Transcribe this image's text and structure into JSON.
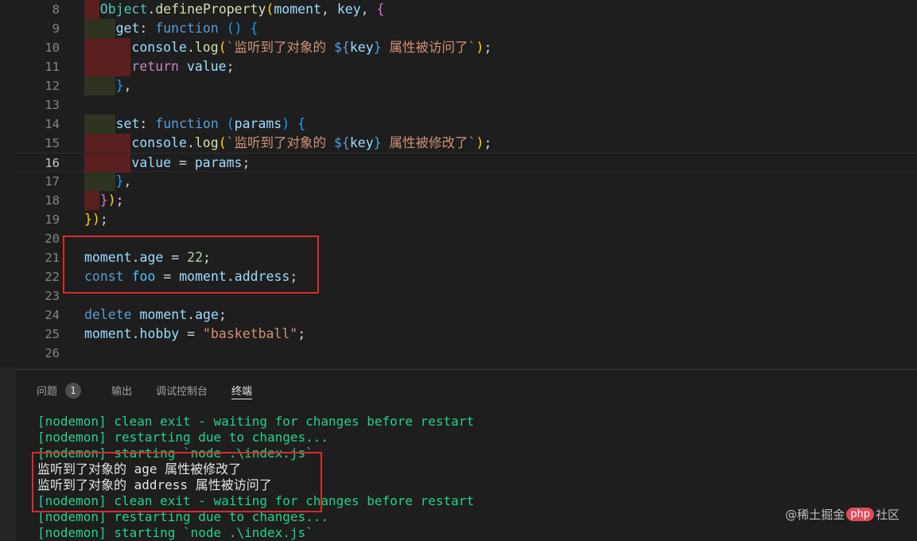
{
  "editor": {
    "lines": [
      {
        "n": "8",
        "tokens": [
          [
            "Object",
            "#4ec9b0"
          ],
          [
            ".",
            "#d4d4d4"
          ],
          [
            "defineProperty",
            "#dcdcaa"
          ],
          [
            "(",
            "#ffd700"
          ],
          [
            "moment",
            "#9cdcfe"
          ],
          [
            ", ",
            "#d4d4d4"
          ],
          [
            "key",
            "#9cdcfe"
          ],
          [
            ", ",
            "#d4d4d4"
          ],
          [
            "{",
            "#da70d6"
          ]
        ]
      },
      {
        "n": "9",
        "tokens": [
          [
            "get",
            "#9cdcfe"
          ],
          [
            ": ",
            "#d4d4d4"
          ],
          [
            "function",
            "#569cd6"
          ],
          [
            " ",
            "#d4d4d4"
          ],
          [
            "()",
            "#179fff"
          ],
          [
            " ",
            "#d4d4d4"
          ],
          [
            "{",
            "#179fff"
          ]
        ]
      },
      {
        "n": "10",
        "tokens": [
          [
            "console",
            "#9cdcfe"
          ],
          [
            ".",
            "#d4d4d4"
          ],
          [
            "log",
            "#dcdcaa"
          ],
          [
            "(",
            "#ffd700"
          ],
          [
            "`监听到了对象的 ",
            "#ce9178"
          ],
          [
            "${",
            "#569cd6"
          ],
          [
            "key",
            "#9cdcfe"
          ],
          [
            "}",
            "#569cd6"
          ],
          [
            " 属性被访问了`",
            "#ce9178"
          ],
          [
            ")",
            "#ffd700"
          ],
          [
            ";",
            "#d4d4d4"
          ]
        ]
      },
      {
        "n": "11",
        "tokens": [
          [
            "return",
            "#c586c0"
          ],
          [
            " ",
            "#d4d4d4"
          ],
          [
            "value",
            "#9cdcfe"
          ],
          [
            ";",
            "#d4d4d4"
          ]
        ]
      },
      {
        "n": "12",
        "tokens": [
          [
            "}",
            "#179fff"
          ],
          [
            ",",
            "#d4d4d4"
          ]
        ]
      },
      {
        "n": "13",
        "tokens": []
      },
      {
        "n": "14",
        "tokens": [
          [
            "set",
            "#9cdcfe"
          ],
          [
            ": ",
            "#d4d4d4"
          ],
          [
            "function",
            "#569cd6"
          ],
          [
            " ",
            "#d4d4d4"
          ],
          [
            "(",
            "#179fff"
          ],
          [
            "params",
            "#9cdcfe"
          ],
          [
            ")",
            "#179fff"
          ],
          [
            " ",
            "#d4d4d4"
          ],
          [
            "{",
            "#179fff"
          ]
        ]
      },
      {
        "n": "15",
        "tokens": [
          [
            "console",
            "#9cdcfe"
          ],
          [
            ".",
            "#d4d4d4"
          ],
          [
            "log",
            "#dcdcaa"
          ],
          [
            "(",
            "#ffd700"
          ],
          [
            "`监听到了对象的 ",
            "#ce9178"
          ],
          [
            "${",
            "#569cd6"
          ],
          [
            "key",
            "#9cdcfe"
          ],
          [
            "}",
            "#569cd6"
          ],
          [
            " 属性被修改了`",
            "#ce9178"
          ],
          [
            ")",
            "#ffd700"
          ],
          [
            ";",
            "#d4d4d4"
          ]
        ]
      },
      {
        "n": "16",
        "tokens": [
          [
            "value",
            "#9cdcfe"
          ],
          [
            " = ",
            "#d4d4d4"
          ],
          [
            "params",
            "#9cdcfe"
          ],
          [
            ";",
            "#d4d4d4"
          ]
        ]
      },
      {
        "n": "17",
        "tokens": [
          [
            "}",
            "#179fff"
          ],
          [
            ",",
            "#d4d4d4"
          ]
        ]
      },
      {
        "n": "18",
        "tokens": [
          [
            "}",
            "#da70d6"
          ],
          [
            ")",
            "#ffd700"
          ],
          [
            ";",
            "#d4d4d4"
          ]
        ]
      },
      {
        "n": "19",
        "tokens": [
          [
            "}",
            "#ffd700"
          ],
          [
            ")",
            "#ffd700"
          ],
          [
            ";",
            "#d4d4d4"
          ]
        ]
      },
      {
        "n": "20",
        "tokens": []
      },
      {
        "n": "21",
        "tokens": [
          [
            "moment",
            "#9cdcfe"
          ],
          [
            ".",
            "#d4d4d4"
          ],
          [
            "age",
            "#9cdcfe"
          ],
          [
            " = ",
            "#d4d4d4"
          ],
          [
            "22",
            "#b5cea8"
          ],
          [
            ";",
            "#d4d4d4"
          ]
        ]
      },
      {
        "n": "22",
        "tokens": [
          [
            "const",
            "#569cd6"
          ],
          [
            " ",
            "#d4d4d4"
          ],
          [
            "foo",
            "#4fc1ff"
          ],
          [
            " = ",
            "#d4d4d4"
          ],
          [
            "moment",
            "#9cdcfe"
          ],
          [
            ".",
            "#d4d4d4"
          ],
          [
            "address",
            "#9cdcfe"
          ],
          [
            ";",
            "#d4d4d4"
          ]
        ]
      },
      {
        "n": "23",
        "tokens": []
      },
      {
        "n": "24",
        "tokens": [
          [
            "delete",
            "#569cd6"
          ],
          [
            " ",
            "#d4d4d4"
          ],
          [
            "moment",
            "#9cdcfe"
          ],
          [
            ".",
            "#d4d4d4"
          ],
          [
            "age",
            "#9cdcfe"
          ],
          [
            ";",
            "#d4d4d4"
          ]
        ]
      },
      {
        "n": "25",
        "tokens": [
          [
            "moment",
            "#9cdcfe"
          ],
          [
            ".",
            "#d4d4d4"
          ],
          [
            "hobby",
            "#9cdcfe"
          ],
          [
            " = ",
            "#d4d4d4"
          ],
          [
            "\"basketball\"",
            "#ce9178"
          ],
          [
            ";",
            "#d4d4d4"
          ]
        ]
      },
      {
        "n": "26",
        "tokens": []
      }
    ],
    "active_line": "16"
  },
  "panel": {
    "tabs": [
      {
        "label": "问题",
        "badge": "1"
      },
      {
        "label": "输出"
      },
      {
        "label": "调试控制台"
      },
      {
        "label": "终端",
        "active": true
      }
    ],
    "terminal": [
      {
        "text": "[nodemon] clean exit - waiting for changes before restart",
        "color": "green"
      },
      {
        "text": "[nodemon] restarting due to changes...",
        "color": "green"
      },
      {
        "text": "[nodemon] starting `node .\\index.js`",
        "color": "green"
      },
      {
        "text": "监听到了对象的 age 属性被修改了",
        "color": "white"
      },
      {
        "text": "监听到了对象的 address 属性被访问了",
        "color": "white"
      },
      {
        "text": "[nodemon] clean exit - waiting for changes before restart",
        "color": "green"
      },
      {
        "text": "[nodemon] restarting due to changes...",
        "color": "green"
      },
      {
        "text": "[nodemon] starting `node .\\index.js`",
        "color": "green"
      }
    ]
  },
  "watermark": {
    "prefix": "@稀土掘金",
    "badge": "php",
    "suffix": "社区"
  },
  "colors": {
    "highlight_box": "#d92b2b",
    "terminal_green": "#23d18b",
    "indent_red": "#5a1f1f",
    "indent_olive": "#2e3421"
  }
}
